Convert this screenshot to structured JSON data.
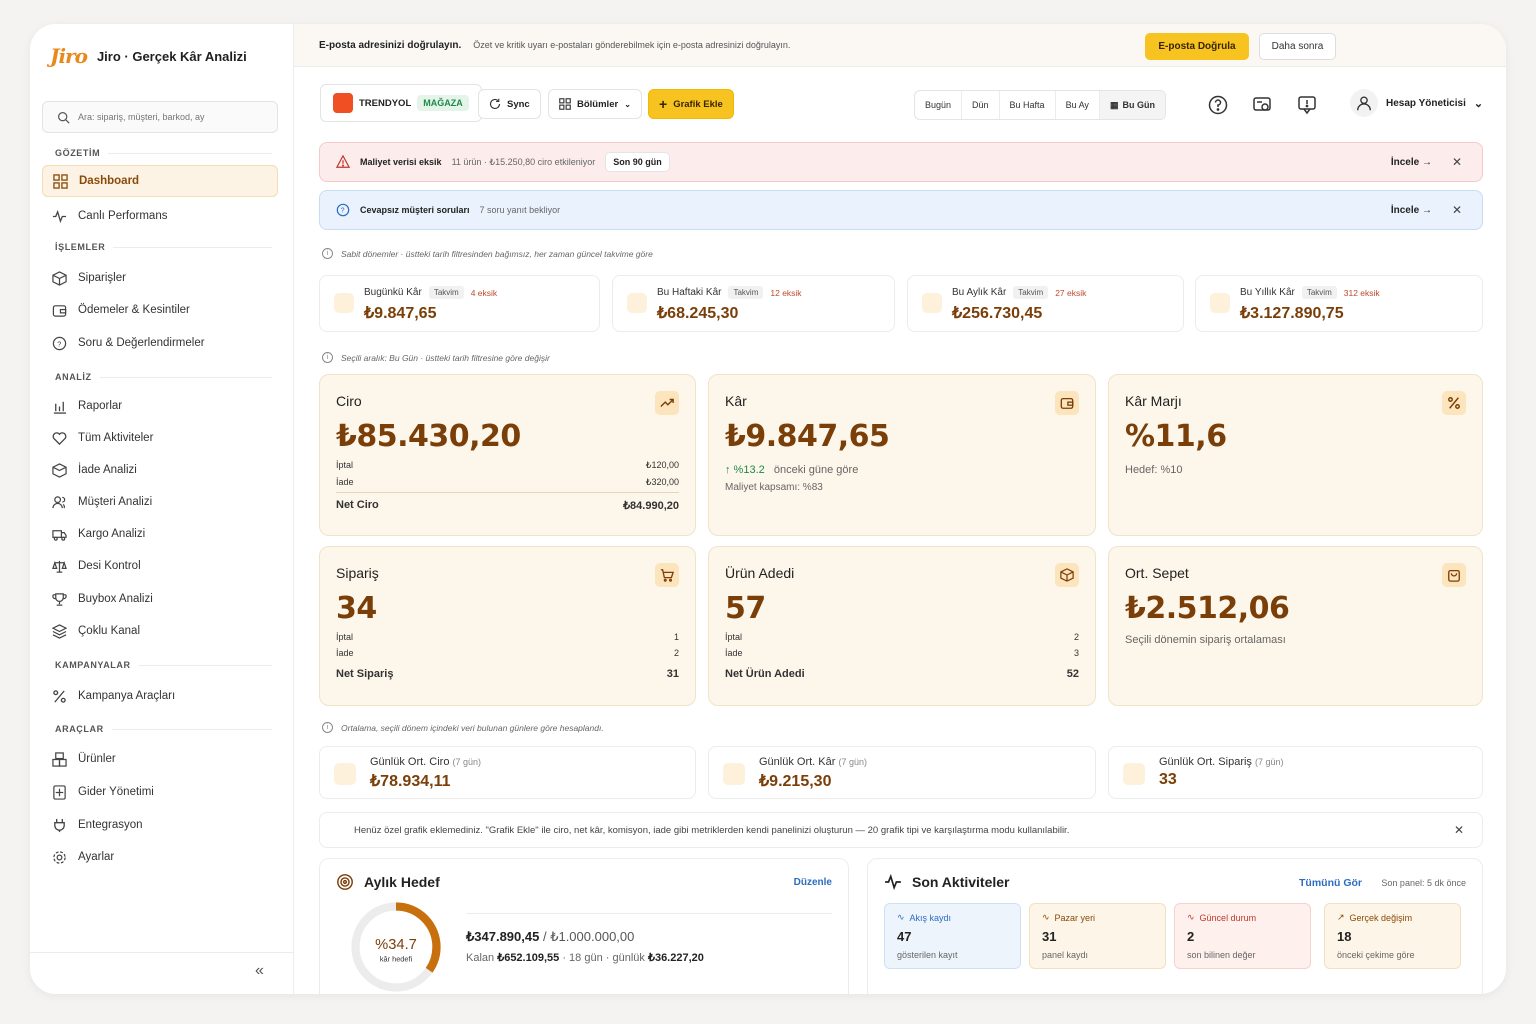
{
  "app": {
    "logo": "Jiro",
    "title": "Jiro · Gerçek Kâr Analizi"
  },
  "search": {
    "placeholder": "Ara: sipariş, müşteri, barkod, ay"
  },
  "sidebar": {
    "sections": [
      "GÖZETİM",
      "İŞLEMLER",
      "ANALİZ",
      "KAMPANYALAR",
      "ARAÇLAR"
    ],
    "items": [
      "Dashboard",
      "Canlı Performans",
      "Siparişler",
      "Ödemeler & Kesintiler",
      "Soru & Değerlendirmeler",
      "Raporlar",
      "Tüm Aktiviteler",
      "İade Analizi",
      "Müşteri Analizi",
      "Kargo Analizi",
      "Desi Kontrol",
      "Buybox Analizi",
      "Çoklu Kanal",
      "Kampanya Araçları",
      "Ürünler",
      "Gider Yönetimi",
      "Entegrasyon",
      "Ayarlar"
    ]
  },
  "banner": {
    "title": "E-posta adresinizi doğrulayın.",
    "text": "Özet ve kritik uyarı e-postaları gönderebilmek için e-posta adresinizi doğrulayın.",
    "verify": "E-posta Doğrula",
    "later": "Daha sonra"
  },
  "toolbar": {
    "store": "TRENDYOL",
    "store_badge": "MAĞAZA",
    "sync": "Sync",
    "sections": "Bölümler",
    "add_chart": "Grafik Ekle",
    "dates": [
      "Bugün",
      "Dün",
      "Bu Hafta",
      "Bu Ay",
      "Bu Gün"
    ],
    "user": "Hesap Yöneticisi"
  },
  "alerts": {
    "cost": {
      "title": "Maliyet verisi eksik",
      "text": "11 ürün · ₺15.250,80 ciro etkileniyor",
      "pill": "Son 90 gün",
      "action": "İncele →"
    },
    "questions": {
      "title": "Cevapsız müşteri soruları",
      "text": "7 soru yanıt bekliyor",
      "action": "İncele →"
    }
  },
  "notes": {
    "fixed": "Sabit dönemler · üstteki tarih filtresinden bağımsız, her zaman güncel takvime göre",
    "range": "Seçili aralık: Bu Gün · üstteki tarih filtresine göre değişir",
    "avg": "Ortalama, seçili dönem içindeki veri bulunan günlere göre hesaplandı."
  },
  "periods": [
    {
      "label": "Bugünkü Kâr",
      "tag": "Takvim",
      "missing": "4 eksik",
      "value": "₺9.847,65"
    },
    {
      "label": "Bu Haftaki Kâr",
      "tag": "Takvim",
      "missing": "12 eksik",
      "value": "₺68.245,30"
    },
    {
      "label": "Bu Aylık Kâr",
      "tag": "Takvim",
      "missing": "27 eksik",
      "value": "₺256.730,45"
    },
    {
      "label": "Bu Yıllık Kâr",
      "tag": "Takvim",
      "missing": "312 eksik",
      "value": "₺3.127.890,75"
    }
  ],
  "kpis": {
    "ciro": {
      "title": "Ciro",
      "value": "₺85.430,20",
      "cancel_label": "İptal",
      "cancel": "₺120,00",
      "return_label": "İade",
      "return": "₺320,00",
      "net_label": "Net Ciro",
      "net": "₺84.990,20"
    },
    "kar": {
      "title": "Kâr",
      "value": "₺9.847,65",
      "change": "↑ %13.2",
      "change_text": "önceki güne göre",
      "coverage": "Maliyet kapsamı: %83"
    },
    "marj": {
      "title": "Kâr Marjı",
      "value": "%11,6",
      "target": "Hedef: %10"
    },
    "siparis": {
      "title": "Sipariş",
      "value": "34",
      "cancel_label": "İptal",
      "cancel": "1",
      "return_label": "İade",
      "return": "2",
      "net_label": "Net Sipariş",
      "net": "31"
    },
    "urun": {
      "title": "Ürün Adedi",
      "value": "57",
      "cancel_label": "İptal",
      "cancel": "2",
      "return_label": "İade",
      "return": "3",
      "net_label": "Net Ürün Adedi",
      "net": "52"
    },
    "sepet": {
      "title": "Ort. Sepet",
      "value": "₺2.512,06",
      "sub": "Seçili dönemin sipariş ortalaması"
    }
  },
  "averages": [
    {
      "label": "Günlük Ort. Ciro",
      "period": "(7 gün)",
      "value": "₺78.934,11"
    },
    {
      "label": "Günlük Ort. Kâr",
      "period": "(7 gün)",
      "value": "₺9.215,30"
    },
    {
      "label": "Günlük Ort. Sipariş",
      "period": "(7 gün)",
      "value": "33"
    }
  ],
  "info": "Henüz özel grafik eklemediniz. \"Grafik Ekle\" ile ciro, net kâr, komisyon, iade gibi metriklerden kendi panelinizi oluşturun — 20 grafik tipi ve karşılaştırma modu kullanılabilir.",
  "goal": {
    "title": "Aylık Hedef",
    "edit": "Düzenle",
    "percent": "%34.7",
    "percent_value": 0.347,
    "ring_label": "kâr hedefi",
    "current": "₺347.890,45",
    "target": "/ ₺1.000.000,00",
    "remaining_prefix": "Kalan",
    "remaining": "₺652.109,55",
    "days": "· 18 gün · günlük",
    "daily": "₺36.227,20"
  },
  "activity": {
    "title": "Son Aktiviteler",
    "see_all": "Tümünü Gör",
    "last": "Son panel: 5 dk önce",
    "cards": [
      {
        "title": "Akış kaydı",
        "value": "47",
        "sub": "gösterilen kayıt"
      },
      {
        "title": "Pazar yeri",
        "value": "31",
        "sub": "panel kaydı"
      },
      {
        "title": "Güncel durum",
        "value": "2",
        "sub": "son bilinen değer"
      },
      {
        "title": "Gerçek değişim",
        "value": "18",
        "sub": "önceki çekime göre"
      }
    ]
  },
  "colors": {
    "accent": "#f6c321",
    "brand": "#e8891a",
    "value": "#7a3e08"
  }
}
